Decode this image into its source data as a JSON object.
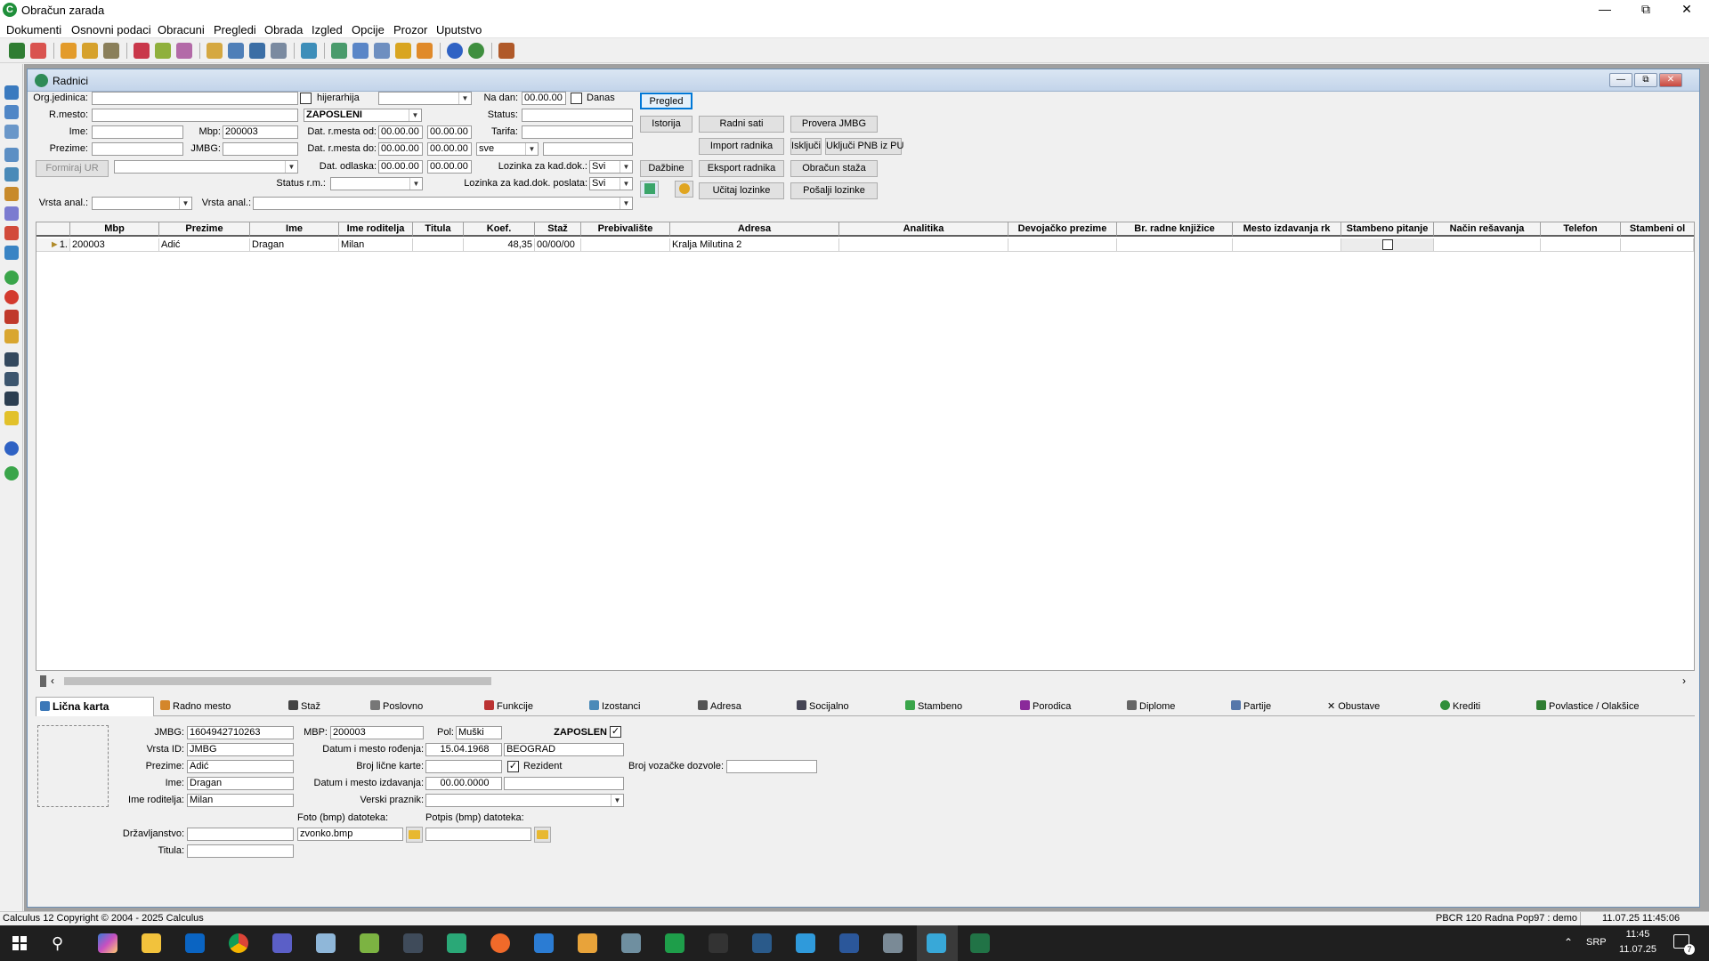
{
  "app": {
    "title": "Obračun zarada"
  },
  "menu": [
    "Dokumenti",
    "Osnovni podaci",
    "Obracuni",
    "Pregledi",
    "Obrada",
    "Izgled",
    "Opcije",
    "Prozor",
    "Uputstvo"
  ],
  "child": {
    "title": "Radnici"
  },
  "filter": {
    "org_label": "Org.jedinica:",
    "hijer_label": "hijerarhija",
    "na_dan_label": "Na dan:",
    "na_dan": "00.00.00",
    "danas_label": "Danas",
    "rmesto_label": "R.mesto:",
    "zaposleni": "ZAPOSLENI",
    "status_label": "Status:",
    "ime_label": "Ime:",
    "mbp_label": "Mbp:",
    "mbp": "200003",
    "dat_od_label": "Dat. r.mesta od:",
    "dat_od_1": "00.00.00",
    "dat_od_2": "00.00.00",
    "tarifa_label": "Tarifa:",
    "prezime_label": "Prezime:",
    "jmbg_label": "JMBG:",
    "dat_do_label": "Dat. r.mesta do:",
    "dat_do_1": "00.00.00",
    "dat_do_2": "00.00.00",
    "sve": "sve",
    "formiraj_label": "Formiraj UR",
    "dat_odlaska_label": "Dat. odlaska:",
    "dat_odl_1": "00.00.00",
    "dat_odl_2": "00.00.00",
    "lozinka_label": "Lozinka za kad.dok.:",
    "lozinka_val": "Svi",
    "status_rm_label": "Status r.m.:",
    "lozinka_poslata_label": "Lozinka za kad.dok. poslata:",
    "lozinka_poslata_val": "Svi",
    "vrsta_anal_label": "Vrsta anal.:",
    "vrsta_anal2_label": "Vrsta anal.:"
  },
  "buttons": {
    "pregled": "Pregled",
    "istorija": "Istorija",
    "dazbine": "Dažbine",
    "radni_sati": "Radni sati",
    "provera_jmbg": "Provera JMBG",
    "import": "Import radnika",
    "iskljuci": "Isključi",
    "ukljuci_pnb": "Uključi PNB iz PU",
    "eksport": "Eksport radnika",
    "obracun_staza": "Obračun staža",
    "ucitaj_lozinke": "Učitaj lozinke",
    "posalji_lozinke": "Pošalji lozinke"
  },
  "grid": {
    "columns": [
      "Mbp",
      "Prezime",
      "Ime",
      "Ime roditelja",
      "Titula",
      "Koef.",
      "Staž",
      "Prebivalište",
      "Adresa",
      "Analitika",
      "Devojačko prezime",
      "Br. radne knjižice",
      "Mesto izdavanja rk",
      "Stambeno pitanje",
      "Način rešavanja",
      "Telefon",
      "Stambeni ol"
    ],
    "rows": [
      {
        "num": "1.",
        "mbp": "200003",
        "prezime": "Adić",
        "ime": "Dragan",
        "roditelj": "Milan",
        "titula": "",
        "koef": "48,35",
        "staz": "00/00/00",
        "prebivaliste": "",
        "adresa": "Kralja Milutina 2"
      }
    ]
  },
  "tabs": [
    "Lična karta",
    "Radno mesto",
    "Staž",
    "Poslovno",
    "Funkcije",
    "Izostanci",
    "Adresa",
    "Socijalno",
    "Stambeno",
    "Porodica",
    "Diplome",
    "Partije",
    "Obustave",
    "Krediti",
    "Povlastice / Olakšice"
  ],
  "details": {
    "jmbg_label": "JMBG:",
    "jmbg": "1604942710263",
    "mbp_label": "MBP:",
    "mbp": "200003",
    "pol_label": "Pol:",
    "pol": "Muški",
    "zaposlen_label": "ZAPOSLEN",
    "vrsta_id_label": "Vrsta ID:",
    "vrsta_id": "JMBG",
    "datum_rodj_label": "Datum i mesto rođenja:",
    "datum_rodj": "15.04.1968",
    "mesto_rodj": "BEOGRAD",
    "prezime_label": "Prezime:",
    "prezime": "Adić",
    "broj_lk_label": "Broj lične karte:",
    "rezident_label": "Rezident",
    "broj_vozacke_label": "Broj vozačke dozvole:",
    "ime_label": "Ime:",
    "ime": "Dragan",
    "datum_izd_label": "Datum i mesto izdavanja:",
    "datum_izd": "00.00.0000",
    "roditelj_label": "Ime roditelja:",
    "roditelj": "Milan",
    "verski_label": "Verski praznik:",
    "foto_label": "Foto (bmp) datoteka:",
    "foto": "zvonko.bmp",
    "potpis_label": "Potpis (bmp) datoteka:",
    "drzavljanstvo_label": "Državljanstvo:",
    "titula_label": "Titula:"
  },
  "status": {
    "left": "Calculus 12  Copyright © 2004 - 2025  Calculus",
    "right1": "PBCR 120 Radna Pop97 : demo",
    "right2": "11.07.25 11:45:06"
  },
  "taskbar": {
    "lang": "SRP",
    "time": "11:45",
    "date": "11.07.25",
    "notif": "7"
  },
  "colors": {
    "accent": "#0078d7",
    "child_title": "#c3d4ea",
    "taskbar": "#1f1f1f"
  }
}
